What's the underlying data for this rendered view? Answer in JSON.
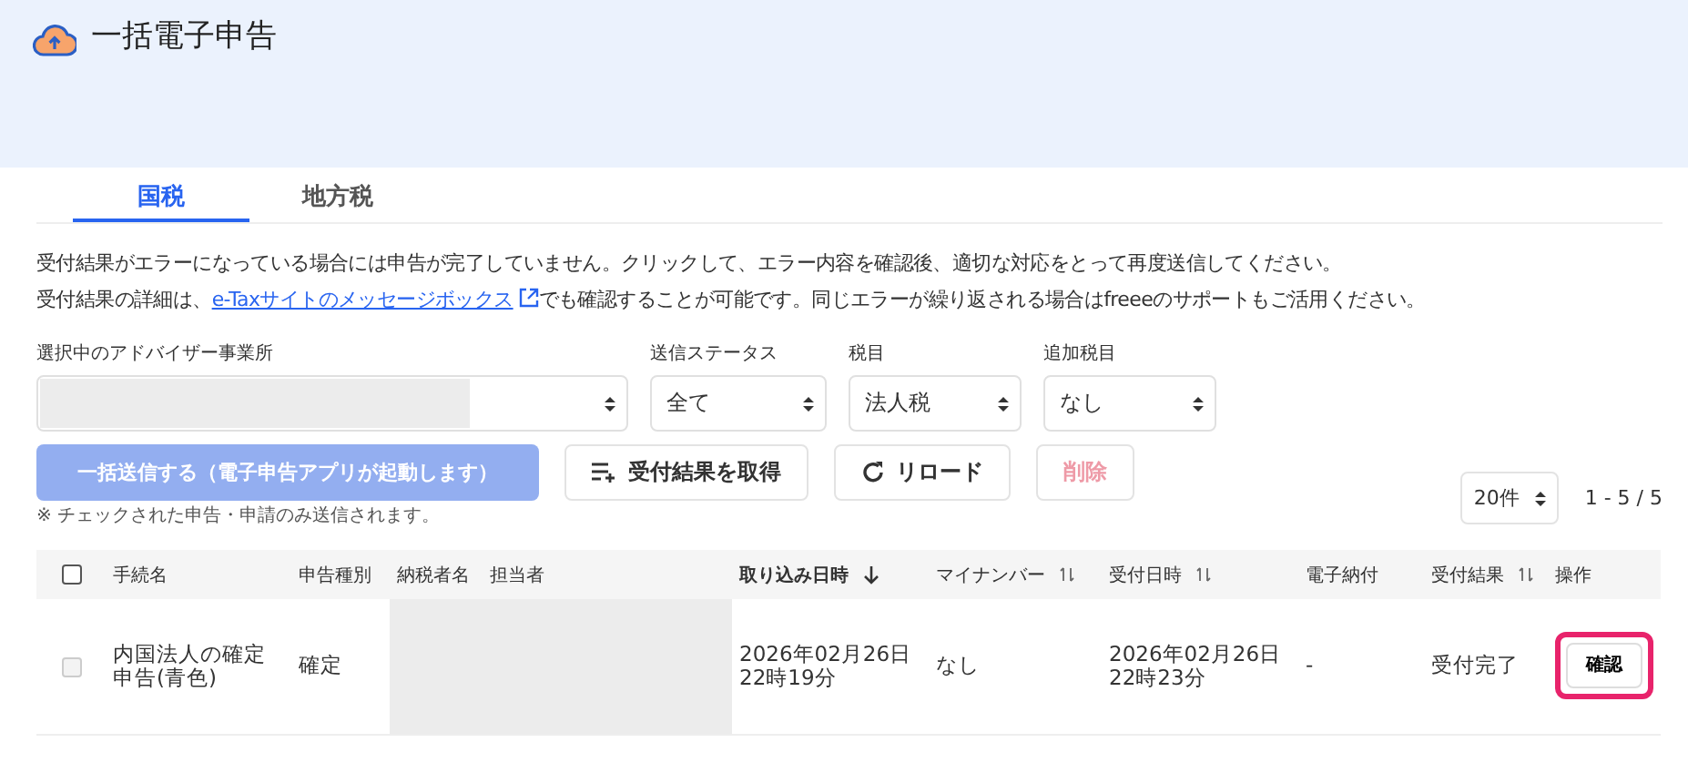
{
  "header": {
    "title": "一括電子申告"
  },
  "tabs": [
    {
      "label": "国税",
      "selected": true
    },
    {
      "label": "地方税",
      "selected": false
    }
  ],
  "notice": {
    "line_1": "受付結果がエラーになっている場合には申告が完了していません。クリックして、エラー内容を確認後、適切な対応をとって再度送信してください。",
    "line_2_before": "受付結果の詳細は、",
    "link": "e-Taxサイトのメッセージボックス",
    "line_2_after": "でも確認することが可能です。同じエラーが繰り返される場合はfreeeのサポートもご活用ください。"
  },
  "filters": [
    {
      "kind": "redacted",
      "label": "選択中のアドバイザー事業所"
    },
    {
      "kind": "select",
      "label": "送信ステータス",
      "value": "全て"
    },
    {
      "kind": "select",
      "label": "税目",
      "value": "法人税"
    },
    {
      "kind": "select",
      "label": "追加税目",
      "value": "なし"
    }
  ],
  "actions": [
    {
      "kind": "primary",
      "label": "一括送信する（電子申告アプリが起動します）",
      "disabled": true
    },
    {
      "kind": "fetch",
      "label": "受付結果を取得",
      "disabled": false
    },
    {
      "kind": "reload",
      "label": "リロード",
      "disabled": false
    },
    {
      "kind": "danger",
      "label": "削除",
      "disabled": true
    }
  ],
  "send_note": "※ チェックされた申告・申請のみ送信されます。",
  "pagination": {
    "per_page": "20件",
    "range": "1 - 5 / 5"
  },
  "table": {
    "select_all": {
      "checked": false
    },
    "columns": [
      {
        "kind": "plain",
        "label": "手続名"
      },
      {
        "kind": "plain",
        "label": "申告種別"
      },
      {
        "kind": "plain",
        "label": "納税者名"
      },
      {
        "kind": "plain",
        "label": "担当者"
      },
      {
        "kind": "sorted",
        "label": "取り込み日時"
      },
      {
        "kind": "sortable",
        "label": "マイナンバー"
      },
      {
        "kind": "sortable",
        "label": "受付日時"
      },
      {
        "kind": "plain",
        "label": "電子納付"
      },
      {
        "kind": "sortable",
        "label": "受付結果"
      },
      {
        "kind": "plain",
        "label": "操作"
      }
    ],
    "rows": [
      {
        "checked": false,
        "disabled": true,
        "cells": [
          {
            "kind": "text",
            "text": "内国法人の確定申告(青色)"
          },
          {
            "kind": "text",
            "text": "確定"
          },
          {
            "kind": "redacted",
            "colspan": 2
          },
          {
            "kind": "text",
            "text": "2026年02月26日 22時19分"
          },
          {
            "kind": "text",
            "text": "なし"
          },
          {
            "kind": "text",
            "text": "2026年02月26日 22時23分"
          },
          {
            "kind": "text",
            "text": "-"
          },
          {
            "kind": "text",
            "text": "受付完了"
          }
        ],
        "action": {
          "label": "確認",
          "highlighted": true
        }
      }
    ]
  }
}
